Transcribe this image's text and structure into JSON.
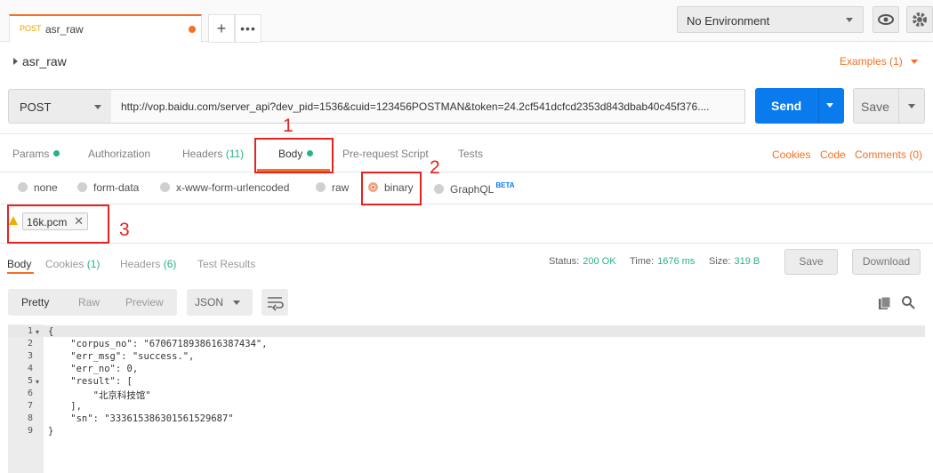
{
  "tab": {
    "method": "POST",
    "name": "asr_raw"
  },
  "environment": {
    "selected": "No Environment"
  },
  "request": {
    "breadcrumb": "asr_raw",
    "examples": "Examples (1)",
    "method": "POST",
    "url": "http://vop.baidu.com/server_api?dev_pid=1536&cuid=123456POSTMAN&token=24.2cf541dcfcd2353d843dbab40c45f376....",
    "send_label": "Send",
    "save_label": "Save"
  },
  "request_tabs": {
    "params": "Params",
    "authorization": "Authorization",
    "headers": "Headers",
    "headers_count": "(11)",
    "body": "Body",
    "prerequest": "Pre-request Script",
    "tests": "Tests",
    "cookies": "Cookies",
    "code": "Code",
    "comments": "Comments (0)"
  },
  "body_modes": {
    "none": "none",
    "form_data": "form-data",
    "urlencoded": "x-www-form-urlencoded",
    "raw": "raw",
    "binary": "binary",
    "graphql": "GraphQL",
    "beta": "BETA",
    "selected": "binary"
  },
  "file": {
    "name": "16k.pcm"
  },
  "response_tabs": {
    "body": "Body",
    "cookies": "Cookies",
    "cookies_count": "(1)",
    "headers": "Headers",
    "headers_count": "(6)",
    "test_results": "Test Results"
  },
  "response_status": {
    "status_label": "Status:",
    "status_value": "200 OK",
    "time_label": "Time:",
    "time_value": "1676 ms",
    "size_label": "Size:",
    "size_value": "319 B",
    "save_label": "Save",
    "download_label": "Download"
  },
  "view": {
    "pretty": "Pretty",
    "raw": "Raw",
    "preview": "Preview",
    "format": "JSON"
  },
  "code_lines": [
    {
      "n": "1",
      "fold": "▾",
      "text": "{"
    },
    {
      "n": "2",
      "fold": "",
      "text": "    \"corpus_no\": \"6706718938616387434\","
    },
    {
      "n": "3",
      "fold": "",
      "text": "    \"err_msg\": \"success.\","
    },
    {
      "n": "4",
      "fold": "",
      "text": "    \"err_no\": 0,"
    },
    {
      "n": "5",
      "fold": "▾",
      "text": "    \"result\": ["
    },
    {
      "n": "6",
      "fold": "",
      "text": "        \"北京科技馆\""
    },
    {
      "n": "7",
      "fold": "",
      "text": "    ],"
    },
    {
      "n": "8",
      "fold": "",
      "text": "    \"sn\": \"333615386301561529687\""
    },
    {
      "n": "9",
      "fold": "",
      "text": "}"
    }
  ],
  "annotations": {
    "one": "1",
    "two": "2",
    "three": "3"
  },
  "colors": {
    "accent": "#f47023",
    "send": "#097bed",
    "green": "#26b47f",
    "annotation": "#e6221f"
  }
}
